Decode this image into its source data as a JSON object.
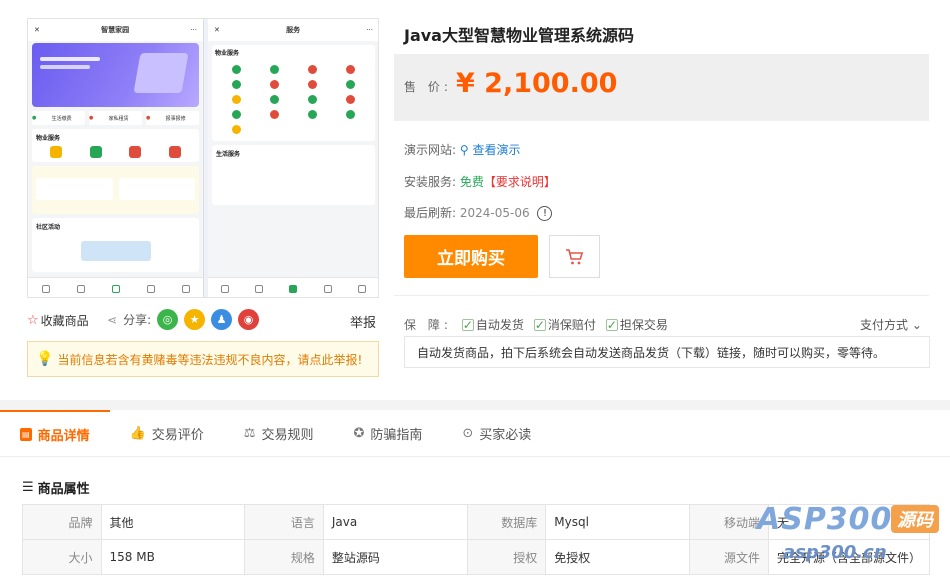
{
  "product": {
    "title": "Java大型智慧物业管理系统源码",
    "price_label": "售 价:",
    "price": "¥ 2,100.00",
    "demo_label": "演示网站:",
    "demo_link": "查看演示",
    "install_label": "安装服务:",
    "install_value": "免费",
    "install_req": "【要求说明】",
    "refresh_label": "最后刷新:",
    "refresh_date": "2024-05-06",
    "buy_label": "立即购买",
    "guarantee_label": "保 障:",
    "guarantees": [
      "自动发货",
      "消保赔付",
      "担保交易"
    ],
    "pay_method": "支付方式",
    "auto_desc": "自动发货商品，拍下后系统会自动发送商品发货（下载）链接，随时可以购买，零等待。"
  },
  "preview": {
    "phone1_title": "智慧家园",
    "phone1_tabs": [
      "生活缴费",
      "家私租赁",
      "报事报修"
    ],
    "phone1_sec1": "物业服务",
    "phone1_sec2": "社区活动",
    "phone2_title": "服务",
    "phone2_sec1": "物业服务",
    "phone2_sec2": "生活服务"
  },
  "share": {
    "collect": "收藏商品",
    "share": "分享:",
    "report": "举报",
    "notice": "当前信息若含有黄赌毒等违法违规不良内容，请点此举报!"
  },
  "tabs": [
    "商品详情",
    "交易评价",
    "交易规则",
    "防骗指南",
    "买家必读"
  ],
  "attributes": {
    "title": "商品属性",
    "rows": [
      [
        [
          "品牌",
          "其他"
        ],
        [
          "语言",
          "Java"
        ],
        [
          "数据库",
          "Mysql"
        ],
        [
          "移动端",
          "无"
        ]
      ],
      [
        [
          "大小",
          "158 MB"
        ],
        [
          "规格",
          "整站源码"
        ],
        [
          "授权",
          "免授权"
        ],
        [
          "源文件",
          "完全开源（含全部源文件）"
        ]
      ]
    ]
  },
  "watermark": {
    "a": "ASP300",
    "b": "源码",
    "c": "asp300.cn"
  },
  "colors": {
    "accent": "#ff6a00",
    "price": "#ff5b00",
    "buy": "#ff8a00",
    "link": "#1f7fd6",
    "free": "#27a657"
  }
}
